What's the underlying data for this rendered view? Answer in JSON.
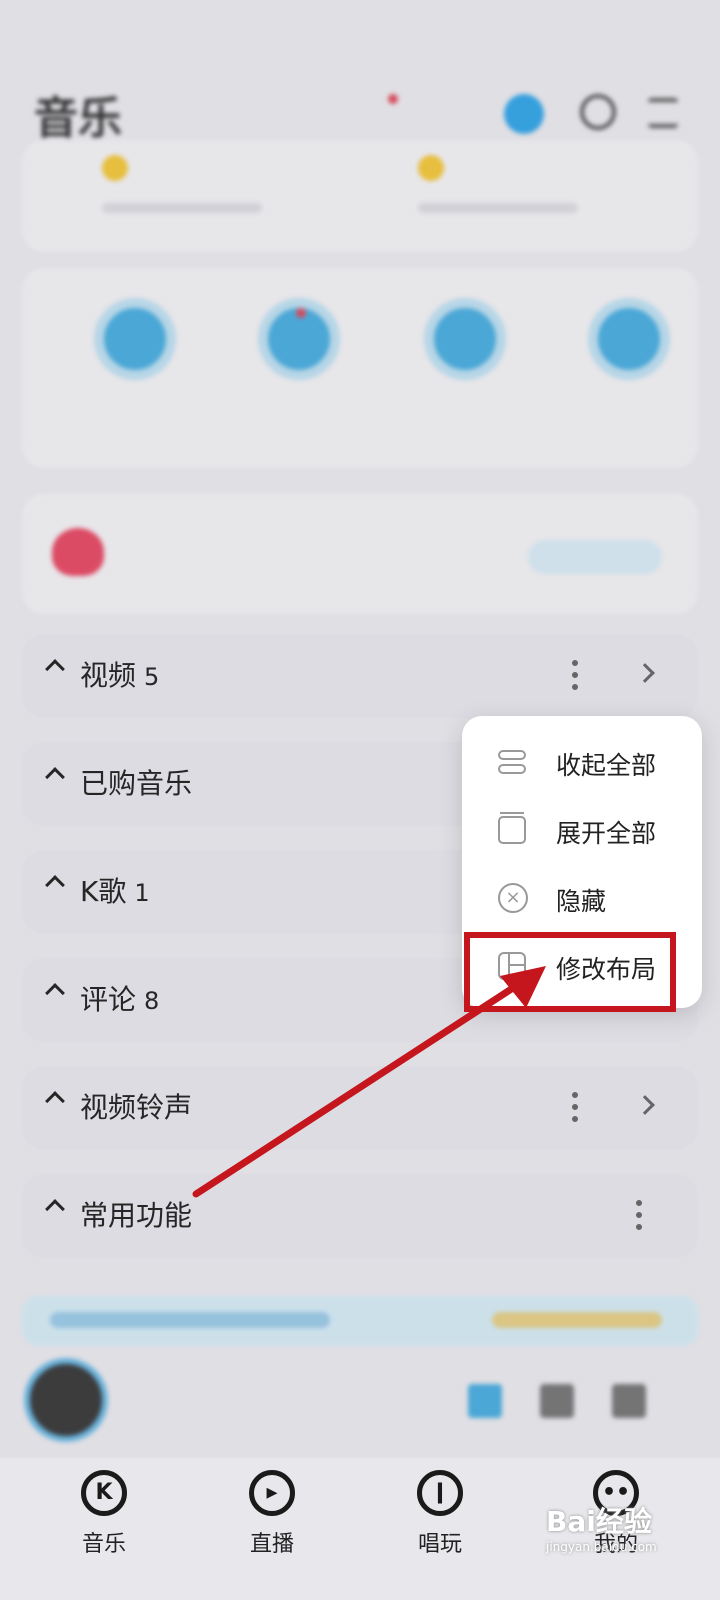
{
  "header": {
    "title": "音乐",
    "tabs": [
      "",
      "",
      ""
    ]
  },
  "sections": [
    {
      "label": "视频",
      "count": "5"
    },
    {
      "label": "已购音乐",
      "count": ""
    },
    {
      "label": "K歌",
      "count": "1"
    },
    {
      "label": "评论",
      "count": "8"
    },
    {
      "label": "视频铃声",
      "count": ""
    },
    {
      "label": "常用功能",
      "count": ""
    }
  ],
  "popup_menu": {
    "items": [
      {
        "label": "收起全部",
        "icon": "collapse-all-icon"
      },
      {
        "label": "展开全部",
        "icon": "expand-all-icon"
      },
      {
        "label": "隐藏",
        "icon": "hide-icon"
      },
      {
        "label": "修改布局",
        "icon": "layout-icon",
        "highlighted": true
      }
    ]
  },
  "bottom_nav": {
    "items": [
      {
        "label": "音乐",
        "icon": "k-music-icon"
      },
      {
        "label": "直播",
        "icon": "live-play-icon"
      },
      {
        "label": "唱玩",
        "icon": "mic-icon"
      },
      {
        "label": "我的",
        "icon": "profile-icon"
      }
    ]
  },
  "watermark": {
    "brand": "Bai经验",
    "url": "jingyan.baidu.com"
  },
  "colors": {
    "annotation_red": "#c4161c",
    "accent_blue": "#33a6e8",
    "badge_red": "#e04a5a"
  }
}
